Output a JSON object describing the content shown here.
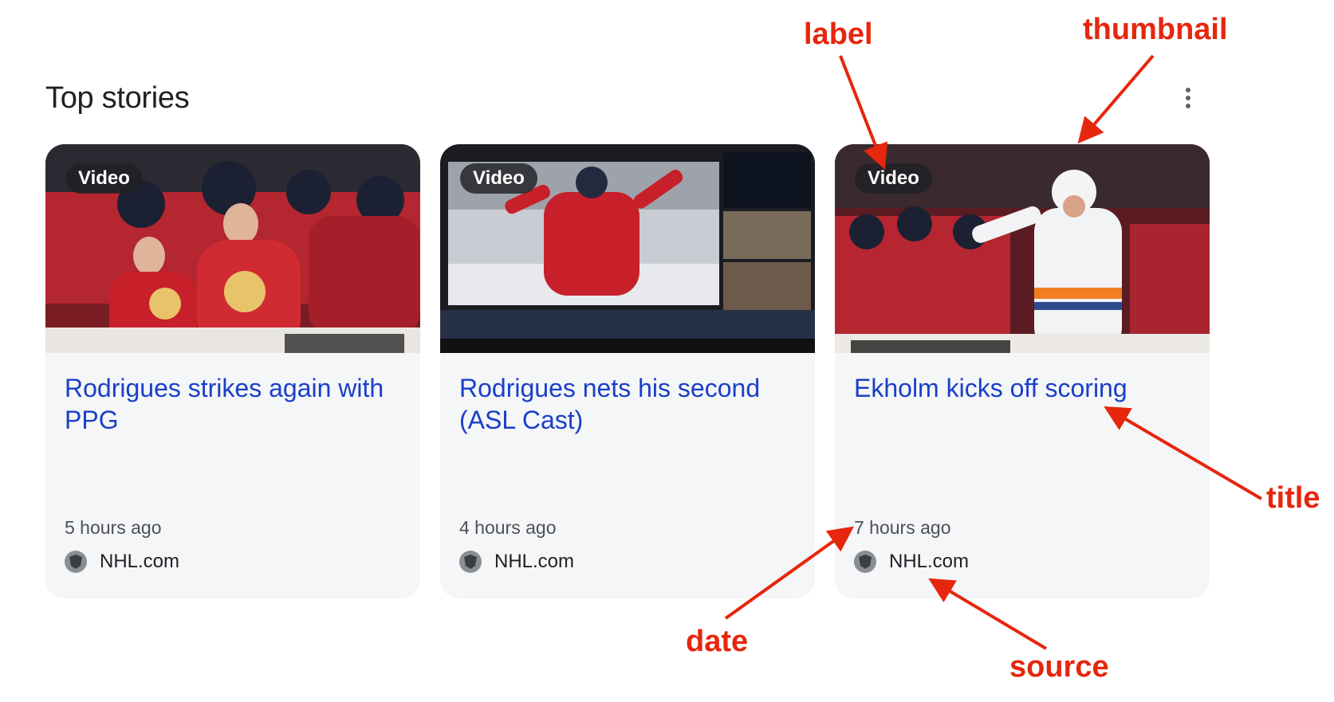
{
  "section": {
    "title": "Top stories",
    "menu_icon": "more-vert-icon"
  },
  "cards": [
    {
      "label": "Video",
      "title": "Rodrigues strikes again with PPG",
      "date": "5 hours ago",
      "source": "NHL.com"
    },
    {
      "label": "Video",
      "title": "Rodrigues nets his second (ASL Cast)",
      "date": "4 hours ago",
      "source": "NHL.com"
    },
    {
      "label": "Video",
      "title": "Ekholm kicks off scoring",
      "date": "7 hours ago",
      "source": "NHL.com"
    }
  ],
  "annotations": {
    "label": "label",
    "thumbnail": "thumbnail",
    "title": "title",
    "date": "date",
    "source": "source",
    "color": "#e6260d"
  },
  "colors": {
    "title_link": "#1a3fc8",
    "card_bg": "#f4f6f8"
  }
}
